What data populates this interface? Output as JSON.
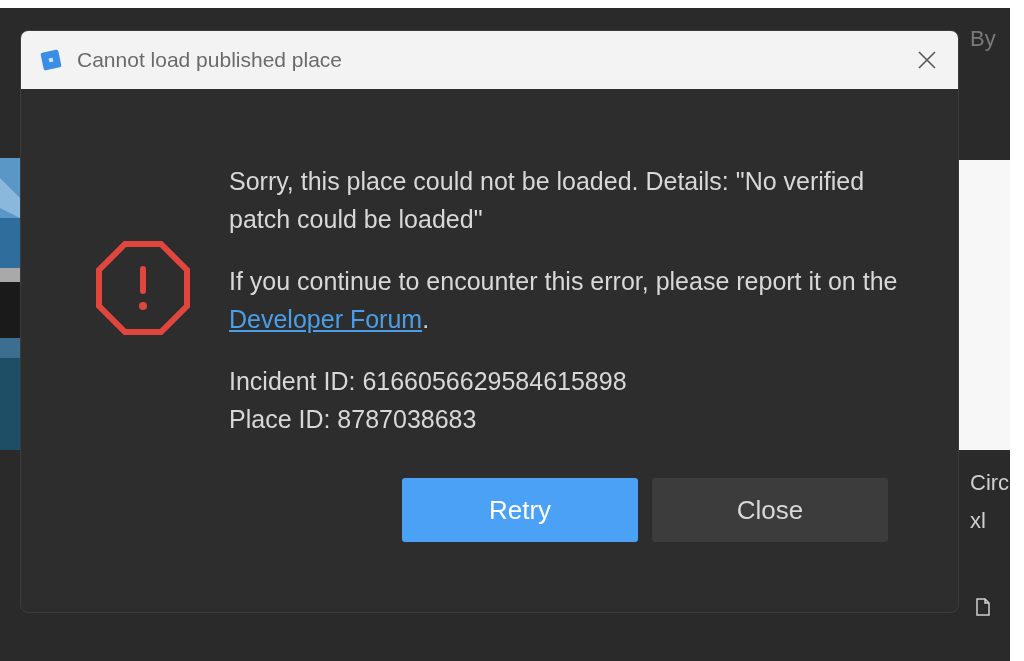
{
  "background": {
    "right_texts": [
      "By",
      "Circ",
      "xl"
    ]
  },
  "dialog": {
    "title": "Cannot load published place",
    "message": "Sorry, this place could not be loaded. Details: \"No verified patch could be loaded\"",
    "help": {
      "before": "If you continue to encounter this error, please report it on the ",
      "link": "Developer Forum",
      "after": "."
    },
    "details": [
      "Incident ID: 6166056629584615898",
      "Place ID: 8787038683"
    ],
    "buttons": [
      {
        "label": "Retry",
        "kind": "primary"
      },
      {
        "label": "Close",
        "kind": "secondary"
      }
    ]
  }
}
